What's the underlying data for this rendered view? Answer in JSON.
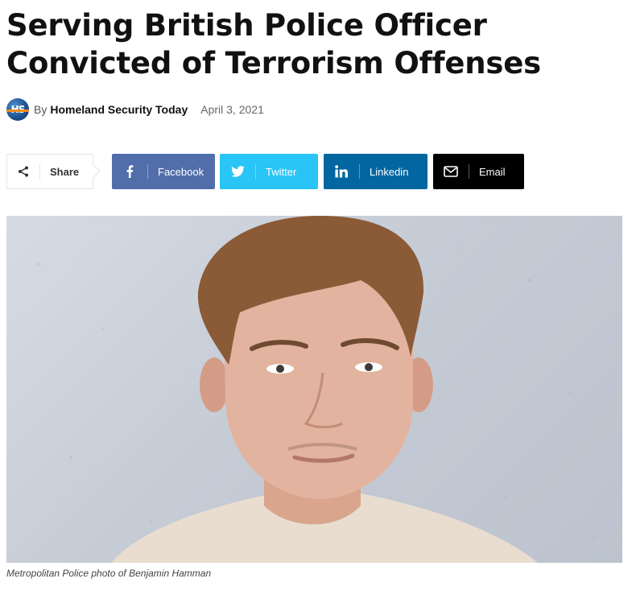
{
  "article": {
    "title": "Serving British Police Officer Convicted of Terrorism Offenses",
    "byline_prefix": "By",
    "author": "Homeland Security Today",
    "date": "April 3, 2021",
    "author_avatar_logo": "HS"
  },
  "share": {
    "label": "Share",
    "icon": "share-icon",
    "buttons": [
      {
        "id": "facebook",
        "label": "Facebook",
        "icon": "facebook-icon",
        "color": "#516eab"
      },
      {
        "id": "twitter",
        "label": "Twitter",
        "icon": "twitter-icon",
        "color": "#29c5f6"
      },
      {
        "id": "linkedin",
        "label": "Linkedin",
        "icon": "linkedin-icon",
        "color": "#0266a0"
      },
      {
        "id": "email",
        "label": "Email",
        "icon": "mail-icon",
        "color": "#000000"
      }
    ]
  },
  "photo": {
    "caption": "Metropolitan Police photo of Benjamin Hamman"
  }
}
